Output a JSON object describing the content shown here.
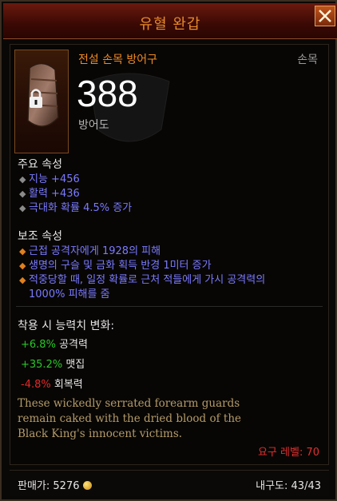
{
  "title": "유혈 완갑",
  "item": {
    "type": "전설 손목 방어구",
    "slot": "손목",
    "armor_value": "388",
    "armor_label": "방어도",
    "icon": "bracers-lock-icon"
  },
  "primary": {
    "heading": "주요 속성",
    "props": [
      "지능 +456",
      "활력 +436",
      "극대화 확률 4.5% 증가"
    ]
  },
  "secondary": {
    "heading": "보조 속성",
    "props": [
      "근접 공격자에게 1928의 피해",
      "생명의 구슬 및 금화 획득 반경 1미터 증가",
      "적중당할 때, 일정 확률로 근처 적들에게 가시 공격력의",
      "1000% 피해를 줌"
    ]
  },
  "changes": {
    "heading": "착용 시 능력치 변화:",
    "items": [
      {
        "value": "+6.8%",
        "label": "공격력"
      },
      {
        "value": "+35.2%",
        "label": "맷집"
      },
      {
        "value": "-4.8%",
        "label": "회복력"
      }
    ]
  },
  "flavor": [
    "These wickedly serrated forearm guards",
    "remain caked with the dried blood of the",
    "Black King's innocent victims."
  ],
  "requirement": "요구 레벨: 70",
  "footer": {
    "sell_label": "판매가:",
    "sell_value": "5276",
    "durability_label": "내구도:",
    "durability_value": "43/43"
  },
  "colors": {
    "legendary": "#ef8a25",
    "magic": "#7a7aff",
    "positive": "#28c828",
    "negative": "#e02a2a"
  }
}
